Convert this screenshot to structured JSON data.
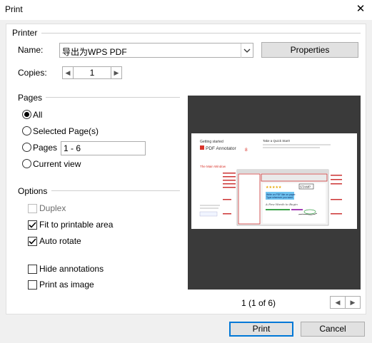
{
  "window": {
    "title": "Print"
  },
  "printer": {
    "section_label": "Printer",
    "name_label": "Name:",
    "name_value": "导出为WPS PDF",
    "properties_label": "Properties",
    "copies_label": "Copies:",
    "copies_value": "1"
  },
  "pages": {
    "section_label": "Pages",
    "all_label": "All",
    "selected_label": "Selected Page(s)",
    "pages_label": "Pages",
    "pages_value": "1 - 6",
    "current_label": "Current view",
    "selected_option": "All"
  },
  "options": {
    "section_label": "Options",
    "duplex_label": "Duplex",
    "fit_label": "Fit to printable area",
    "autorotate_label": "Auto rotate",
    "hide_annotations_label": "Hide annotations",
    "print_as_image_label": "Print as image",
    "checked": {
      "duplex": false,
      "fit": true,
      "autorotate": true,
      "hide_annotations": false,
      "print_as_image": false
    }
  },
  "preview": {
    "page_indicator": "1 (1 of 6)",
    "content": {
      "heading": "Getting started",
      "product": "PDF Annotator",
      "version": "8",
      "section": "The Main Window",
      "tour_title": "Take a Quick Start!",
      "note_line1": "Write on PDF like on paper.",
      "note_line2": "Type wherever you want.",
      "stamp": "STAMP",
      "handwriting": "A Few Words to Begin",
      "accent": "#d9342b"
    }
  },
  "footer": {
    "print_label": "Print",
    "cancel_label": "Cancel"
  }
}
